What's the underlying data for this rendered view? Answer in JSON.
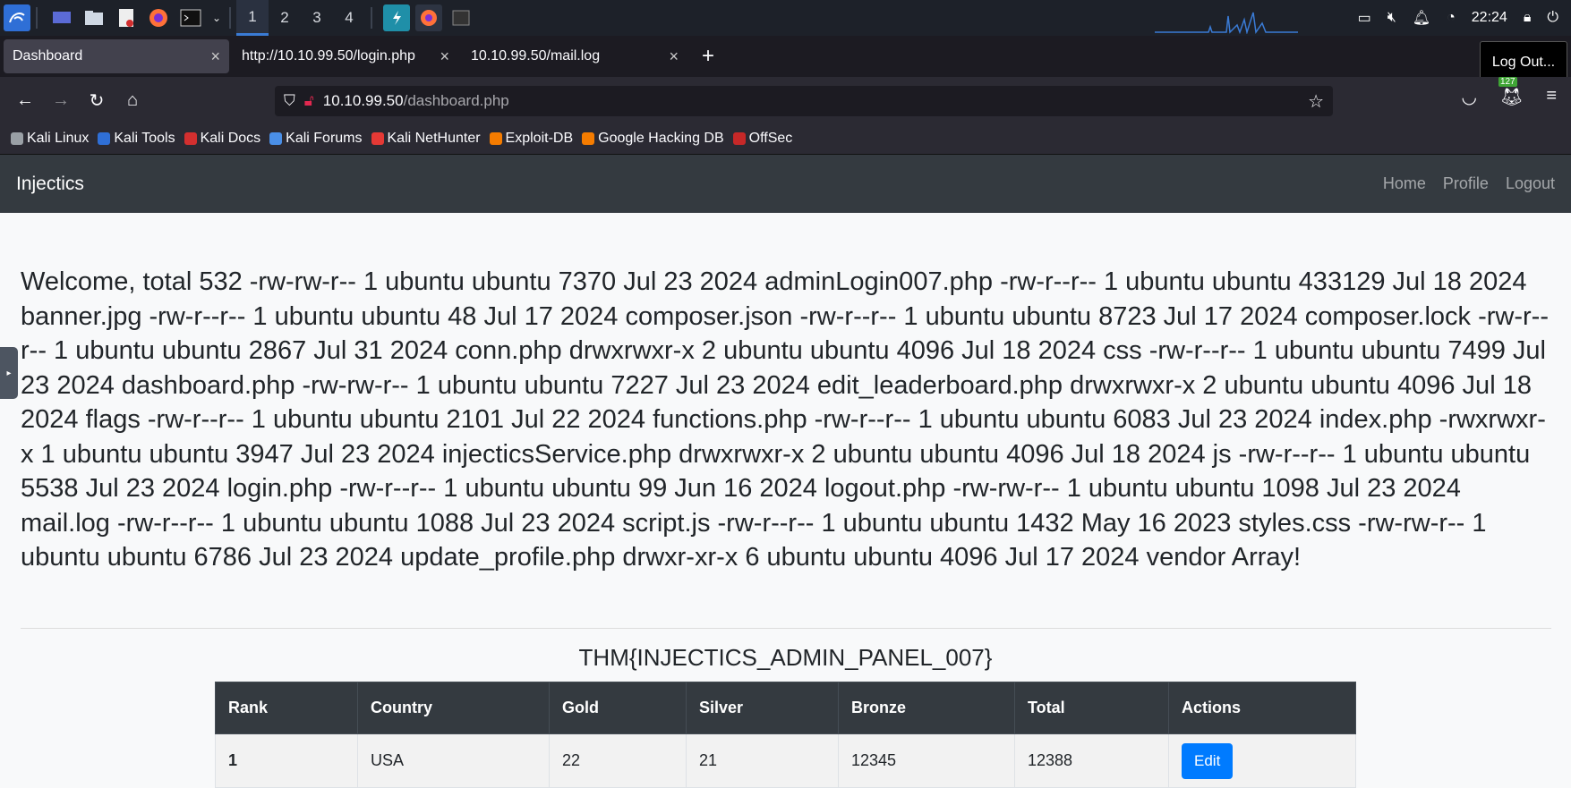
{
  "os_panel": {
    "workspaces": [
      "1",
      "2",
      "3",
      "4"
    ],
    "active_workspace": "1",
    "clock": "22:24",
    "icons": [
      "kali-menu-icon",
      "desktop-icon",
      "file-manager-icon",
      "text-editor-icon",
      "firefox-icon",
      "terminal-icon"
    ]
  },
  "browser": {
    "tabs": [
      {
        "label": "Dashboard",
        "active": true
      },
      {
        "label": "http://10.10.99.50/login.php",
        "active": false
      },
      {
        "label": "10.10.99.50/mail.log",
        "active": false
      }
    ],
    "tooltip": "Log Out...",
    "url_host": "10.10.99.50",
    "url_path": "/dashboard.php",
    "extension_badge": "127",
    "bookmarks": [
      {
        "label": "Kali Linux",
        "color": "#9aa0a6"
      },
      {
        "label": "Kali Tools",
        "color": "#2f6fd6"
      },
      {
        "label": "Kali Docs",
        "color": "#d32f2f"
      },
      {
        "label": "Kali Forums",
        "color": "#4a8fe7"
      },
      {
        "label": "Kali NetHunter",
        "color": "#e53935"
      },
      {
        "label": "Exploit-DB",
        "color": "#f57c00"
      },
      {
        "label": "Google Hacking DB",
        "color": "#f57c00"
      },
      {
        "label": "OffSec",
        "color": "#c62828"
      }
    ]
  },
  "site": {
    "brand": "Injectics",
    "nav": [
      "Home",
      "Profile",
      "Logout"
    ],
    "welcome_text": "Welcome, total 532 -rw-rw-r-- 1 ubuntu ubuntu 7370 Jul 23 2024 adminLogin007.php -rw-r--r-- 1 ubuntu ubuntu 433129 Jul 18 2024 banner.jpg -rw-r--r-- 1 ubuntu ubuntu 48 Jul 17 2024 composer.json -rw-r--r-- 1 ubuntu ubuntu 8723 Jul 17 2024 composer.lock -rw-r--r-- 1 ubuntu ubuntu 2867 Jul 31 2024 conn.php drwxrwxr-x 2 ubuntu ubuntu 4096 Jul 18 2024 css -rw-r--r-- 1 ubuntu ubuntu 7499 Jul 23 2024 dashboard.php -rw-rw-r-- 1 ubuntu ubuntu 7227 Jul 23 2024 edit_leaderboard.php drwxrwxr-x 2 ubuntu ubuntu 4096 Jul 18 2024 flags -rw-r--r-- 1 ubuntu ubuntu 2101 Jul 22 2024 functions.php -rw-r--r-- 1 ubuntu ubuntu 6083 Jul 23 2024 index.php -rwxrwxr-x 1 ubuntu ubuntu 3947 Jul 23 2024 injecticsService.php drwxrwxr-x 2 ubuntu ubuntu 4096 Jul 18 2024 js -rw-r--r-- 1 ubuntu ubuntu 5538 Jul 23 2024 login.php -rw-r--r-- 1 ubuntu ubuntu 99 Jun 16 2024 logout.php -rw-rw-r-- 1 ubuntu ubuntu 1098 Jul 23 2024 mail.log -rw-r--r-- 1 ubuntu ubuntu 1088 Jul 23 2024 script.js -rw-r--r-- 1 ubuntu ubuntu 1432 May 16 2023 styles.css -rw-rw-r-- 1 ubuntu ubuntu 6786 Jul 23 2024 update_profile.php drwxr-xr-x 6 ubuntu ubuntu 4096 Jul 17 2024 vendor Array!",
    "flag": "THM{INJECTICS_ADMIN_PANEL_007}",
    "table": {
      "headers": [
        "Rank",
        "Country",
        "Gold",
        "Silver",
        "Bronze",
        "Total",
        "Actions"
      ],
      "rows": [
        {
          "rank": "1",
          "country": "USA",
          "gold": "22",
          "silver": "21",
          "bronze": "12345",
          "total": "12388",
          "action": "Edit"
        }
      ]
    }
  }
}
